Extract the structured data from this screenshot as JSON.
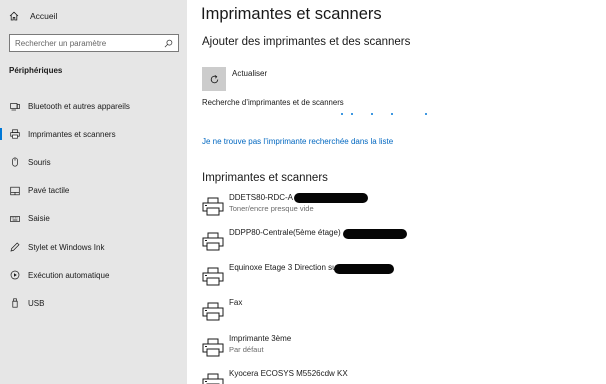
{
  "sidebar": {
    "home_label": "Accueil",
    "search_placeholder": "Rechercher un paramètre",
    "section_title": "Périphériques",
    "items": [
      {
        "label": "Bluetooth et autres appareils",
        "icon": "bluetooth-device-icon"
      },
      {
        "label": "Imprimantes et scanners",
        "icon": "printer-icon",
        "active": true
      },
      {
        "label": "Souris",
        "icon": "mouse-icon"
      },
      {
        "label": "Pavé tactile",
        "icon": "touchpad-icon"
      },
      {
        "label": "Saisie",
        "icon": "keyboard-icon"
      },
      {
        "label": "Stylet et Windows Ink",
        "icon": "pen-icon"
      },
      {
        "label": "Exécution automatique",
        "icon": "autoplay-icon"
      },
      {
        "label": "USB",
        "icon": "usb-icon"
      }
    ]
  },
  "main": {
    "title": "Imprimantes et scanners",
    "add_section_title": "Ajouter des imprimantes et des scanners",
    "refresh_label": "Actualiser",
    "searching_text": "Recherche d’imprimantes et de scanners",
    "not_listed_link": "Je ne trouve pas l’imprimante recherchée dans la liste",
    "list_section_title": "Imprimantes et scanners",
    "printers": [
      {
        "name": "DDETS80-RDC-A",
        "status": "Toner/encre presque vide",
        "redacted": true
      },
      {
        "name": "DDPP80-Centrale(5ème étage)",
        "status": "",
        "redacted": true
      },
      {
        "name": "Equinoxe Etage 3 Direction su",
        "status": "",
        "redacted": true
      },
      {
        "name": "Fax",
        "status": "",
        "redacted": false
      },
      {
        "name": "Imprimante 3ème",
        "status": "Par défaut",
        "redacted": false
      },
      {
        "name": "Kyocera ECOSYS M5526cdw KX",
        "status": "",
        "redacted": false
      }
    ]
  },
  "colors": {
    "accent": "#0078d7",
    "link": "#0067c0",
    "sidebar_bg": "#e6e6e6"
  }
}
